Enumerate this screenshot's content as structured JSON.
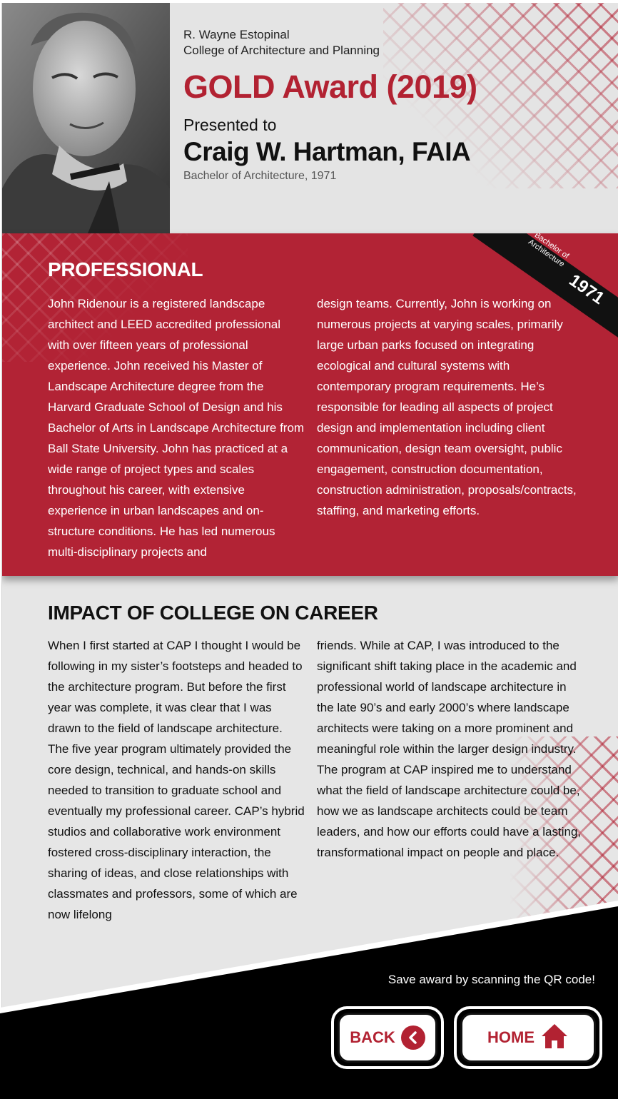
{
  "header": {
    "college_line1": "R. Wayne Estopinal",
    "college_line2": "College of Architecture and Planning",
    "award_title": "GOLD Award (2019)",
    "presented_label": "Presented to",
    "honoree_name": "Craig W. Hartman, FAIA",
    "degree": "Bachelor of Architecture, 1971"
  },
  "ribbon": {
    "label_line1": "Bachelor of",
    "label_line2": "Architecture",
    "year": "1971"
  },
  "professional": {
    "title": "PROFESSIONAL",
    "col_left": "John Ridenour is a registered landscape architect and LEED accredited professional with over fifteen years of professional experience. John received his Master of Landscape Architecture degree from the Harvard Graduate School of Design and his Bachelor of Arts in Landscape Architecture from Ball State University. John has practiced at a wide range of project types and scales throughout his career, with extensive experience in urban landscapes and on-structure conditions. He has led numerous multi-disciplinary projects and",
    "col_right": "design teams. Currently, John is working on numerous projects at varying scales, primarily large urban parks focused on integrating ecological and cultural systems with contemporary program requirements. He’s responsible for leading all aspects of project design and implementation including client communication, design team oversight, public engagement, construction documentation, construction administration, proposals/contracts, staffing, and marketing efforts."
  },
  "impact": {
    "title": "IMPACT OF COLLEGE ON CAREER",
    "col_left": "When I first started at CAP I thought I would be following in my sister’s footsteps and headed to the architecture program. But before the first year was complete, it was clear that I was drawn to the field of landscape architecture. The five year program ultimately provided the core design, technical, and hands-on skills needed to transition to graduate school and eventually my professional career. CAP’s hybrid studios and collaborative work environment fostered cross-disciplinary interaction, the sharing of ideas, and close relationships with classmates and professors, some of which are now lifelong",
    "col_right": "friends. While at CAP, I was introduced to the significant shift taking place in the academic and professional world of landscape architecture in the late 90’s and early 2000’s where landscape architects were taking on a more prominent and meaningful role within the larger design industry. The program at CAP inspired me to understand what the field of landscape architecture could be, how we as landscape architects could be team leaders, and how our efforts could have a lasting, transformational impact on people and place."
  },
  "footer": {
    "qr_text": "Save award by scanning the QR code!",
    "back_label": "BACK",
    "home_label": "HOME"
  },
  "colors": {
    "brand_red": "#b22232",
    "background": "#e6e6e6",
    "footer": "#000000"
  },
  "icons": {
    "back": "chevron-left-icon",
    "home": "home-icon"
  }
}
